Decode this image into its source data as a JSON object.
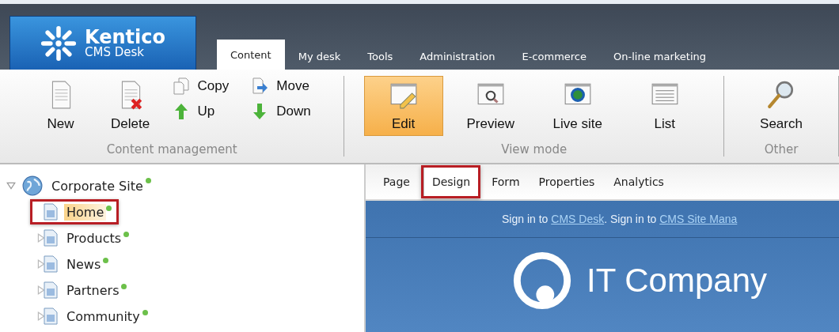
{
  "logo": {
    "brand": "Kentico",
    "product": "CMS Desk"
  },
  "tabs": [
    {
      "label": "Content",
      "selected": true
    },
    {
      "label": "My desk",
      "selected": false
    },
    {
      "label": "Tools",
      "selected": false
    },
    {
      "label": "Administration",
      "selected": false
    },
    {
      "label": "E-commerce",
      "selected": false
    },
    {
      "label": "On-line marketing",
      "selected": false
    }
  ],
  "ribbon": [
    {
      "title": "Content management",
      "buttons": [
        {
          "label": "New",
          "kind": "large",
          "selected": false
        },
        {
          "label": "Delete",
          "kind": "large",
          "selected": false
        },
        {
          "label": "Copy",
          "kind": "small",
          "selected": false
        },
        {
          "label": "Move",
          "kind": "small",
          "selected": false
        },
        {
          "label": "Up",
          "kind": "small",
          "selected": false
        },
        {
          "label": "Down",
          "kind": "small",
          "selected": false
        }
      ]
    },
    {
      "title": "View mode",
      "buttons": [
        {
          "label": "Edit",
          "kind": "large",
          "selected": true
        },
        {
          "label": "Preview",
          "kind": "large",
          "selected": false
        },
        {
          "label": "Live site",
          "kind": "large",
          "selected": false
        },
        {
          "label": "List",
          "kind": "large",
          "selected": false
        }
      ]
    },
    {
      "title": "Other",
      "buttons": [
        {
          "label": "Search",
          "kind": "large",
          "selected": false
        }
      ]
    }
  ],
  "tree": {
    "label": "Corporate Site",
    "expanded": true,
    "published": true,
    "children": [
      {
        "label": "Home",
        "expandable": false,
        "selected": true,
        "annotated": true,
        "published": true
      },
      {
        "label": "Products",
        "expandable": true,
        "selected": false,
        "annotated": false,
        "published": true
      },
      {
        "label": "News",
        "expandable": true,
        "selected": false,
        "annotated": false,
        "published": true
      },
      {
        "label": "Partners",
        "expandable": true,
        "selected": false,
        "annotated": false,
        "published": true
      },
      {
        "label": "Community",
        "expandable": true,
        "selected": false,
        "annotated": false,
        "published": true
      }
    ]
  },
  "page_tabs": [
    {
      "label": "Page",
      "selected": false,
      "annotated": false
    },
    {
      "label": "Design",
      "selected": true,
      "annotated": true
    },
    {
      "label": "Form",
      "selected": false,
      "annotated": false
    },
    {
      "label": "Properties",
      "selected": false,
      "annotated": false
    },
    {
      "label": "Analytics",
      "selected": false,
      "annotated": false
    }
  ],
  "preview": {
    "sign_in": [
      {
        "kind": "text",
        "text": "Sign in to "
      },
      {
        "kind": "link",
        "text": "CMS Desk"
      },
      {
        "kind": "text",
        "text": ". Sign in to "
      },
      {
        "kind": "link",
        "text": "CMS Site Mana"
      }
    ],
    "site_name": "IT Company"
  }
}
